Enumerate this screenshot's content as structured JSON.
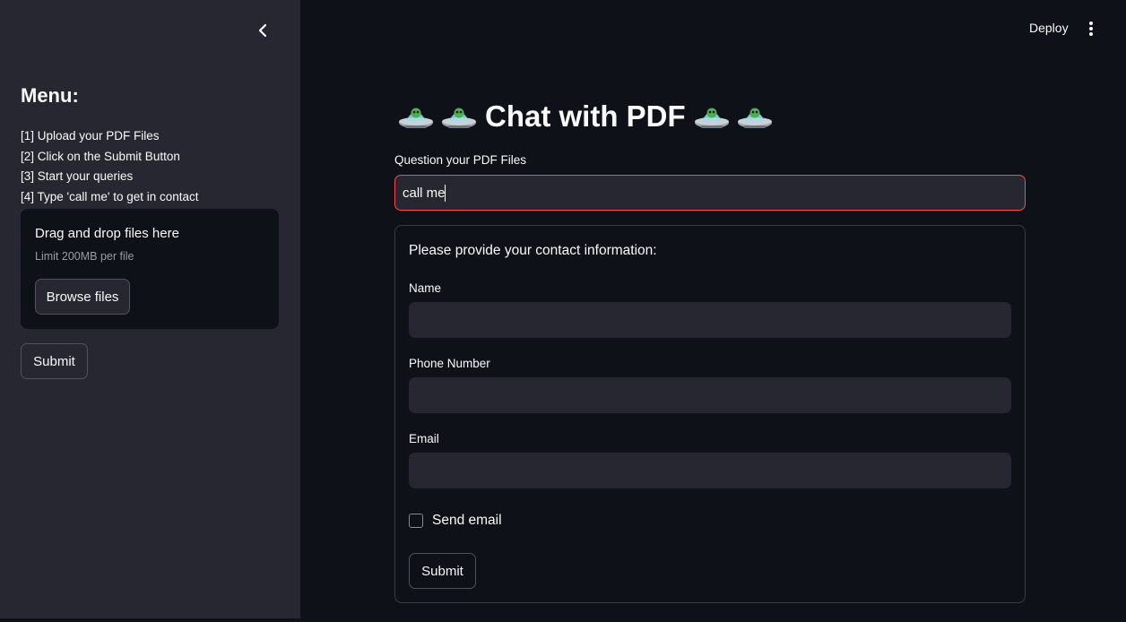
{
  "sidebar": {
    "menu_title": "Menu:",
    "items": [
      "[1] Upload your PDF Files",
      "[2] Click on the Submit Button",
      "[3] Start your queries",
      "[4] Type 'call me' to get in contact"
    ],
    "uploader": {
      "title": "Drag and drop files here",
      "limit": "Limit 200MB per file",
      "browse_label": "Browse files"
    },
    "submit_label": "Submit"
  },
  "header": {
    "deploy_label": "Deploy"
  },
  "main": {
    "title": "Chat with PDF",
    "question_label": "Question your PDF Files",
    "question_value": "call me",
    "form": {
      "heading": "Please provide your contact information:",
      "name_label": "Name",
      "name_value": "",
      "phone_label": "Phone Number",
      "phone_value": "",
      "email_label": "Email",
      "email_value": "",
      "send_email_label": "Send email",
      "send_email_checked": false,
      "submit_label": "Submit"
    }
  },
  "icons": {
    "collapse": "chevron-left-icon",
    "menu": "kebab-menu-icon",
    "title_decoration": "ufo-icon"
  },
  "colors": {
    "background": "#0e1117",
    "sidebar": "#262730",
    "accent": "#ff4b4b",
    "text": "#fafafa"
  }
}
